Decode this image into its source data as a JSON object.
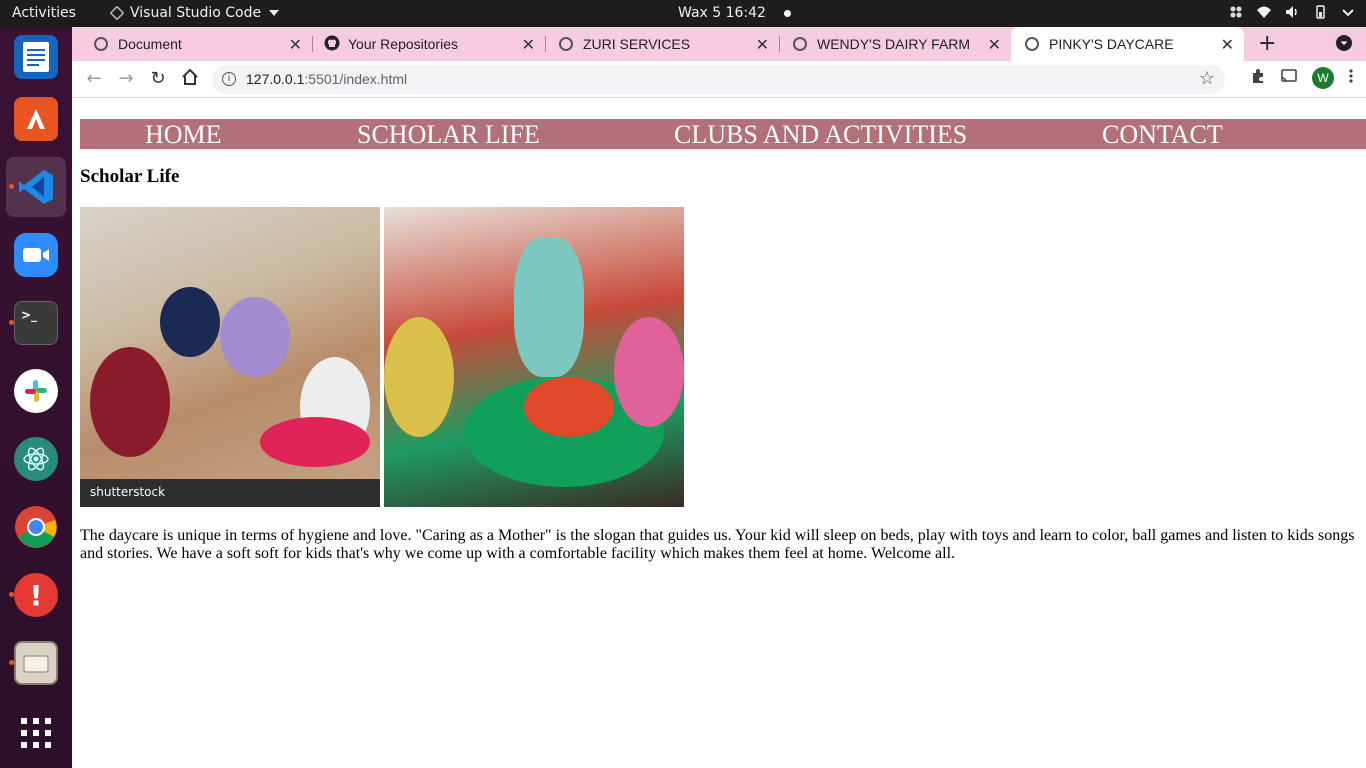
{
  "topbar": {
    "activities": "Activities",
    "app_name": "Visual Studio Code",
    "clock": "Wax 5  16:42"
  },
  "dock": {
    "items": [
      {
        "name": "writer-icon",
        "color": "#1565c0"
      },
      {
        "name": "software-store-icon",
        "color": "#e95420"
      },
      {
        "name": "vscode-icon",
        "color": "#1e88e5"
      },
      {
        "name": "zoom-icon",
        "color": "#2d8cff"
      },
      {
        "name": "terminal-icon",
        "color": "#3a3a3a"
      },
      {
        "name": "slack-icon",
        "color": "#ffffff"
      },
      {
        "name": "atom-icon",
        "color": "#2b8a7e"
      },
      {
        "name": "chrome-icon",
        "color": "#ffffff"
      },
      {
        "name": "update-notifier-icon",
        "color": "#e53935"
      },
      {
        "name": "files-icon",
        "color": "#d9d2c5"
      },
      {
        "name": "app-grid-icon",
        "color": "#ffffff"
      }
    ]
  },
  "browser": {
    "tabs": [
      {
        "label": "Document"
      },
      {
        "label": "Your Repositories"
      },
      {
        "label": "ZURI SERVICES"
      },
      {
        "label": "WENDY'S DAIRY FARM"
      },
      {
        "label": "PINKY'S DAYCARE"
      }
    ],
    "url_host": "127.0.0.1",
    "url_path": ":5501/index.html",
    "profile_initial": "W"
  },
  "site": {
    "nav": [
      "HOME",
      "SCHOLAR LIFE",
      "CLUBS AND ACTIVITIES",
      "CONTACT"
    ],
    "heading": "Scholar Life",
    "watermark": "shutterstock",
    "paragraph": "The daycare is unique in terms of hygiene and love. \"Caring as a Mother\" is the slogan that guides us. Your kid will sleep on beds, play with toys and learn to color, ball games and listen to kids songs and stories. We have a soft soft for kids that's why we come up with a comfortable facility which makes them feel at home. Welcome all.",
    "nav_color": "#b2707a",
    "tab_bar_color": "#f7cce0"
  }
}
